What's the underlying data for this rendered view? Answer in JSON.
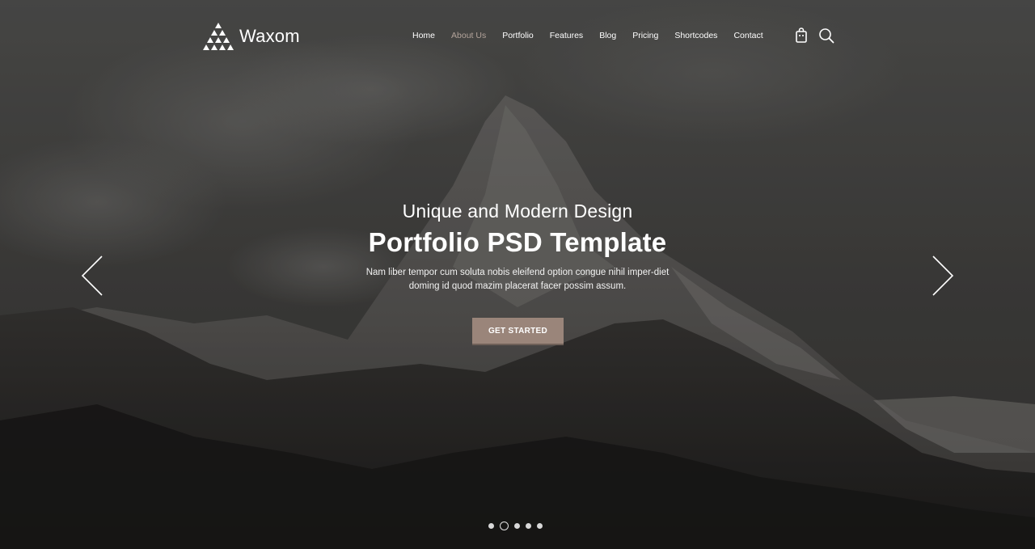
{
  "brand": {
    "name": "Waxom"
  },
  "nav": {
    "items": [
      {
        "label": "Home",
        "active": false
      },
      {
        "label": "About Us",
        "active": true
      },
      {
        "label": "Portfolio",
        "active": false
      },
      {
        "label": "Features",
        "active": false
      },
      {
        "label": "Blog",
        "active": false
      },
      {
        "label": "Pricing",
        "active": false
      },
      {
        "label": "Shortcodes",
        "active": false
      },
      {
        "label": "Contact",
        "active": false
      }
    ]
  },
  "icons": {
    "cart": "shopping-bag-icon",
    "search": "search-icon",
    "prev": "chevron-left-icon",
    "next": "chevron-right-icon",
    "logo": "triangle-logo-icon"
  },
  "hero": {
    "eyebrow": "Unique and Modern Design",
    "headline": "Portfolio PSD Template",
    "lede": "Nam liber tempor cum soluta nobis eleifend option congue nihil imper-diet doming id quod mazim placerat facer possim assum.",
    "cta_label": "GET STARTED"
  },
  "slider": {
    "slide_count": 5,
    "active_slide": 2
  },
  "colors": {
    "accent": "#9a857a",
    "nav_active": "#b3a49b",
    "text": "#ffffff"
  }
}
